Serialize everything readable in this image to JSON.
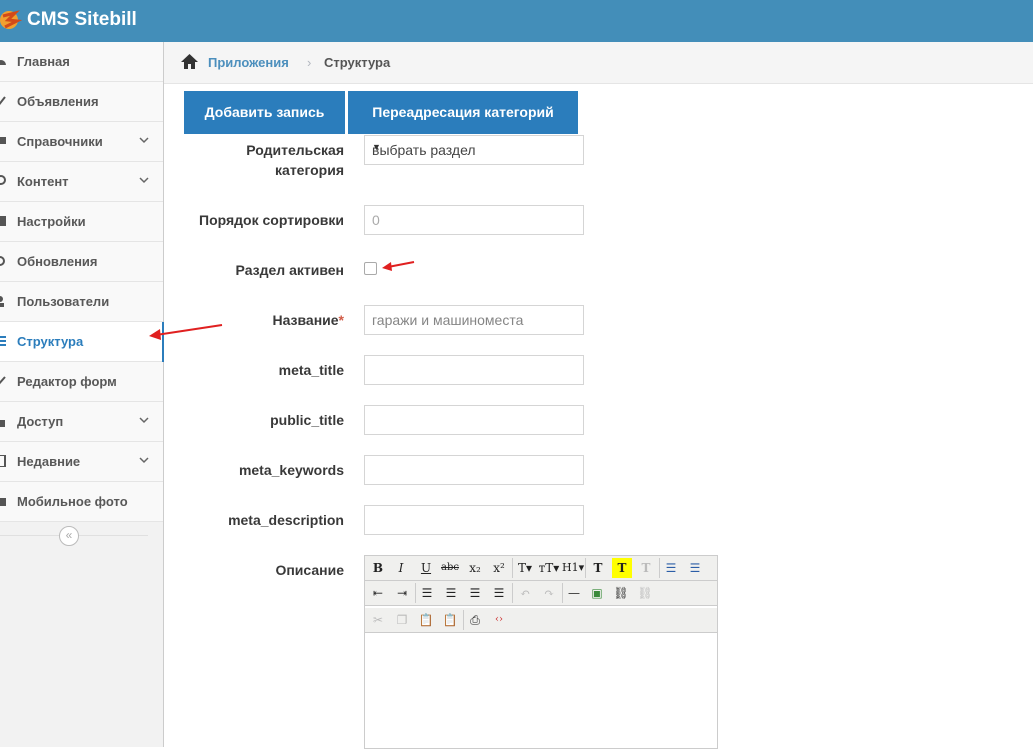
{
  "app": {
    "brand": "CMS Sitebill"
  },
  "sidebar": {
    "items": [
      {
        "label": "Главная",
        "icon": "tachometer-icon",
        "has_submenu": false
      },
      {
        "label": "Объявления",
        "icon": "pencil-icon",
        "has_submenu": false
      },
      {
        "label": "Справочники",
        "icon": "desktop-icon",
        "has_submenu": true
      },
      {
        "label": "Контент",
        "icon": "leaf-icon",
        "has_submenu": true
      },
      {
        "label": "Настройки",
        "icon": "cog-icon",
        "has_submenu": false
      },
      {
        "label": "Обновления",
        "icon": "refresh-icon",
        "has_submenu": false
      },
      {
        "label": "Пользователи",
        "icon": "user-icon",
        "has_submenu": false
      },
      {
        "label": "Структура",
        "icon": "list-icon",
        "has_submenu": false,
        "active": true
      },
      {
        "label": "Редактор форм",
        "icon": "edit-icon",
        "has_submenu": false
      },
      {
        "label": "Доступ",
        "icon": "lock-icon",
        "has_submenu": true
      },
      {
        "label": "Недавние",
        "icon": "tablet-icon",
        "has_submenu": true
      },
      {
        "label": "Мобильное фото",
        "icon": "camera-icon",
        "has_submenu": false
      }
    ],
    "collapse_glyph": "«"
  },
  "breadcrumb": {
    "items": [
      "Приложения",
      "Структура"
    ],
    "separator": "›"
  },
  "tabs": {
    "add_record": "Добавить запись",
    "redirect_categories": "Переадресация категорий"
  },
  "form": {
    "parent_category": {
      "label": "Родительская категория",
      "value": "выбрать раздел"
    },
    "sort_order": {
      "label": "Порядок сортировки",
      "placeholder": "0"
    },
    "active": {
      "label": "Раздел активен",
      "checked": false
    },
    "name": {
      "label": "Название",
      "required_mark": "*",
      "value": "гаражи и машиноместа"
    },
    "meta_title": {
      "label": "meta_title",
      "value": ""
    },
    "public_title": {
      "label": "public_title",
      "value": ""
    },
    "meta_keywords": {
      "label": "meta_keywords",
      "value": ""
    },
    "meta_description": {
      "label": "meta_description",
      "value": ""
    },
    "description": {
      "label": "Описание"
    }
  },
  "editor": {
    "row1": [
      {
        "name": "bold-icon",
        "glyph": "B"
      },
      {
        "name": "italic-icon",
        "glyph": "I"
      },
      {
        "name": "underline-icon",
        "glyph": "U"
      },
      {
        "name": "strikethrough-icon",
        "glyph": "abc"
      },
      {
        "name": "subscript-icon",
        "glyph": "x₂"
      },
      {
        "name": "superscript-icon",
        "glyph": "x²"
      },
      {
        "name": "font-family-icon",
        "glyph": "T▾"
      },
      {
        "name": "font-size-icon",
        "glyph": "тT▾"
      },
      {
        "name": "heading-icon",
        "glyph": "H1▾"
      },
      {
        "name": "text-color-icon",
        "glyph": "T"
      },
      {
        "name": "highlight-icon",
        "glyph": "T"
      },
      {
        "name": "remove-format-icon",
        "glyph": "T"
      },
      {
        "name": "bullet-list-icon",
        "glyph": "☰"
      },
      {
        "name": "numbered-list-icon",
        "glyph": "☰"
      }
    ],
    "row2": [
      {
        "name": "outdent-icon",
        "glyph": "⇤"
      },
      {
        "name": "indent-icon",
        "glyph": "⇥"
      },
      {
        "name": "align-left-icon",
        "glyph": "☰"
      },
      {
        "name": "align-center-icon",
        "glyph": "☰"
      },
      {
        "name": "align-right-icon",
        "glyph": "☰"
      },
      {
        "name": "justify-icon",
        "glyph": "☰"
      },
      {
        "name": "undo-icon",
        "glyph": "↶"
      },
      {
        "name": "redo-icon",
        "glyph": "↷"
      },
      {
        "name": "horizontal-rule-icon",
        "glyph": "—"
      },
      {
        "name": "image-icon",
        "glyph": "▣"
      },
      {
        "name": "link-icon",
        "glyph": "⛓"
      },
      {
        "name": "unlink-icon",
        "glyph": "⛓"
      }
    ],
    "row3": [
      {
        "name": "cut-icon",
        "glyph": "✂"
      },
      {
        "name": "copy-icon",
        "glyph": "❐"
      },
      {
        "name": "paste-icon",
        "glyph": "📋"
      },
      {
        "name": "paste-text-icon",
        "glyph": "📋"
      },
      {
        "name": "print-icon",
        "glyph": "⎙"
      },
      {
        "name": "source-code-icon",
        "glyph": "‹›"
      }
    ]
  },
  "colors": {
    "header": "#438eb9",
    "primary_button": "#2b7dbc",
    "active_nav": "#2b7dbc",
    "annotation_arrow": "#e02020"
  }
}
